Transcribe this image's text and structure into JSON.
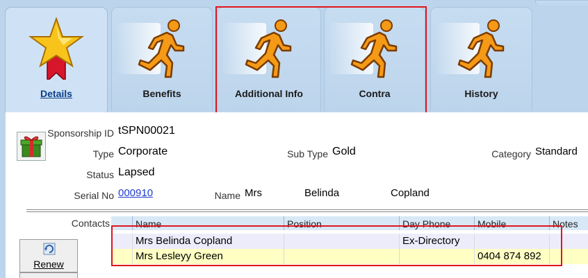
{
  "tabs": {
    "details": "Details",
    "benefits": "Benefits",
    "additional_info": "Additional Info",
    "contra": "Contra",
    "history": "History"
  },
  "form": {
    "sponsorship_id_label": "Sponsorship ID",
    "sponsorship_id": "tSPN00021",
    "type_label": "Type",
    "type": "Corporate",
    "sub_type_label": "Sub Type",
    "sub_type": "Gold",
    "category_label": "Category",
    "category": "Standard",
    "status_label": "Status",
    "status": "Lapsed",
    "serial_no_label": "Serial No",
    "serial_no": "000910",
    "name_label": "Name",
    "name_title": "Mrs",
    "name_first": "Belinda",
    "name_last": "Copland"
  },
  "contacts": {
    "label": "Contacts",
    "columns": [
      "Name",
      "Position",
      "Day Phone",
      "Mobile",
      "Notes"
    ],
    "rows": [
      {
        "name": "Mrs Belinda Copland",
        "position": "",
        "day_phone": "Ex-Directory",
        "mobile": "",
        "notes": ""
      },
      {
        "name": "Mrs Lesleyy Green",
        "position": "",
        "day_phone": "",
        "mobile": "0404 874 892",
        "notes": ""
      }
    ]
  },
  "buttons": {
    "renew": "Renew"
  },
  "icons": {
    "details": "star-ribbon-icon",
    "other_tabs": "running-man-icon",
    "sponsorship": "gift-icon",
    "renew": "renew-icon"
  },
  "colors": {
    "highlight": "#e0141e",
    "accent_running": "#f59a16",
    "active_tab_text": "#0b3e8a"
  }
}
